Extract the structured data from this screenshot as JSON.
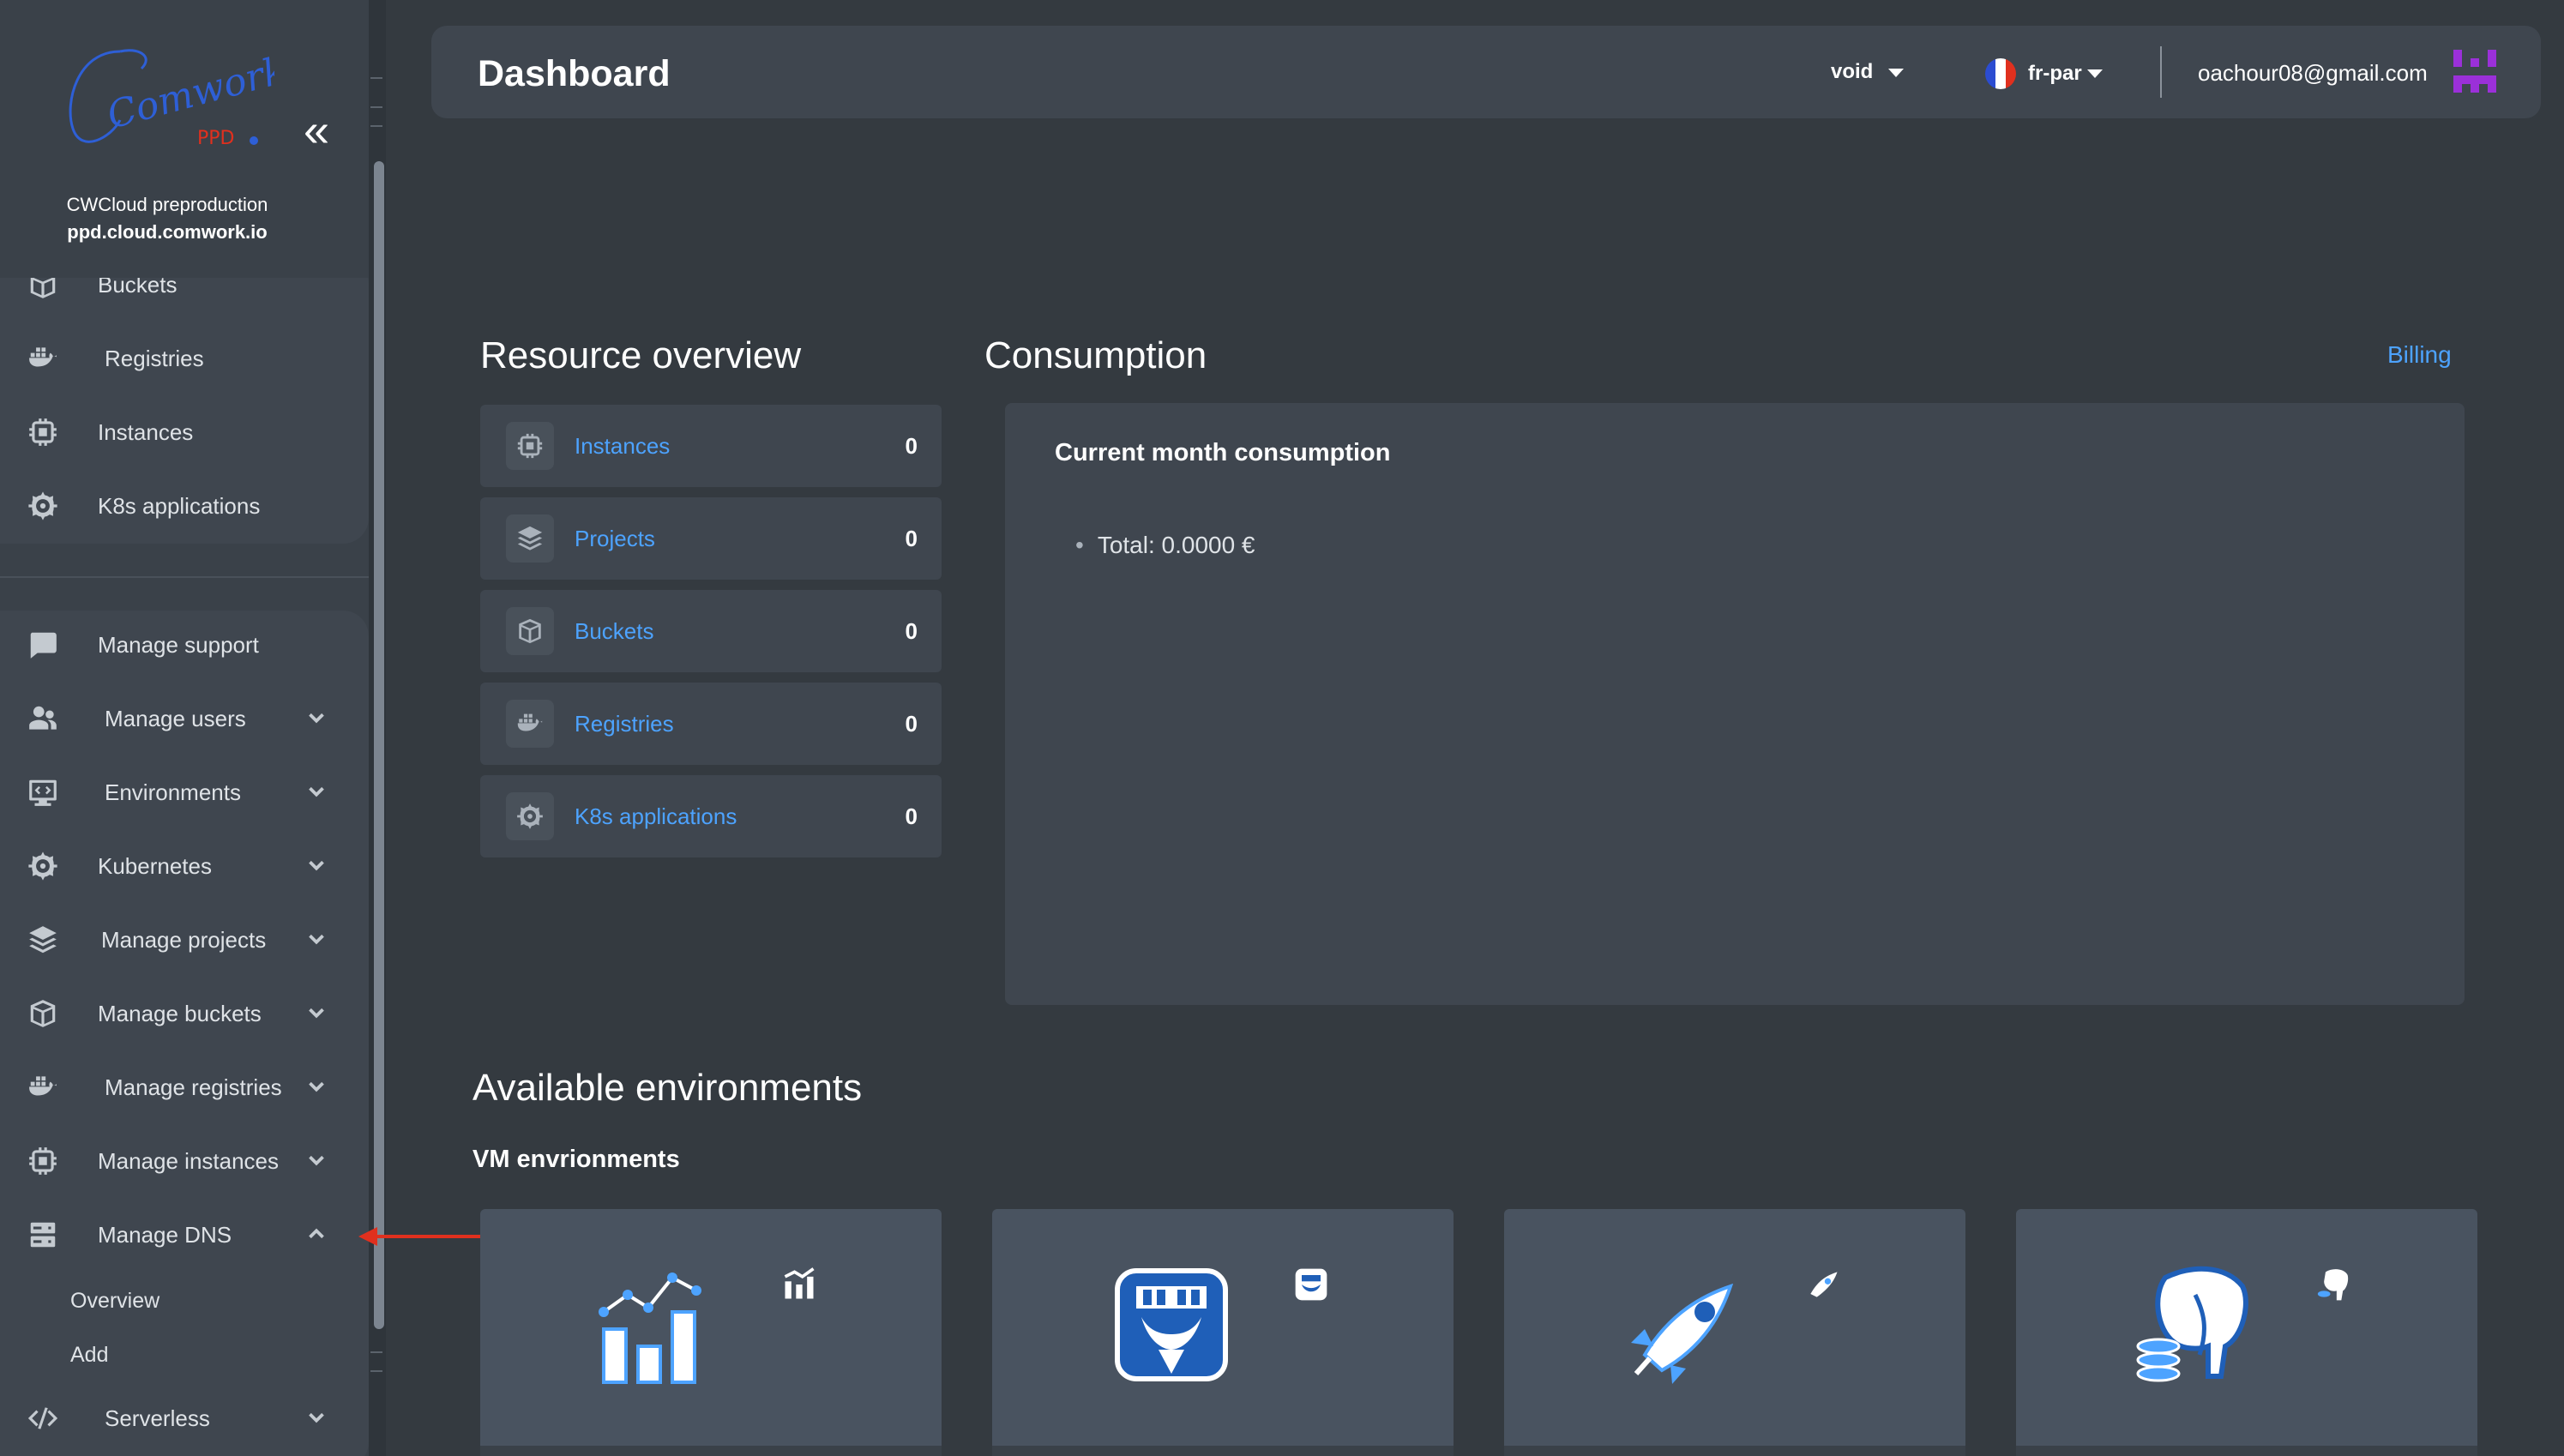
{
  "sidebar": {
    "logo_text": "Comwork",
    "logo_sub": "PPD",
    "org_name": "CWCloud preproduction",
    "org_domain": "ppd.cloud.comwork.io",
    "top_items": [
      {
        "label": "Buckets",
        "icon": "bucket-icon"
      },
      {
        "label": "Registries",
        "icon": "docker-icon"
      },
      {
        "label": "Instances",
        "icon": "chip-icon"
      },
      {
        "label": "K8s applications",
        "icon": "helm-icon"
      }
    ],
    "manage_items": [
      {
        "label": "Manage support",
        "icon": "chat-icon"
      },
      {
        "label": "Manage users",
        "icon": "users-icon"
      },
      {
        "label": "Environments",
        "icon": "code-monitor-icon"
      },
      {
        "label": "Kubernetes",
        "icon": "helm-icon"
      },
      {
        "label": "Manage projects",
        "icon": "layers-icon"
      },
      {
        "label": "Manage buckets",
        "icon": "bucket-icon"
      },
      {
        "label": "Manage registries",
        "icon": "docker-icon"
      },
      {
        "label": "Manage instances",
        "icon": "chip-icon"
      },
      {
        "label": "Manage DNS",
        "icon": "server-icon"
      }
    ],
    "dns_subitems": [
      "Overview",
      "Add"
    ],
    "serverless_label": "Serverless"
  },
  "header": {
    "title": "Dashboard",
    "project": "void",
    "region": "fr-par",
    "user_email": "oachour08@gmail.com"
  },
  "resource_overview": {
    "title": "Resource overview",
    "items": [
      {
        "label": "Instances",
        "count": "0"
      },
      {
        "label": "Projects",
        "count": "0"
      },
      {
        "label": "Buckets",
        "count": "0"
      },
      {
        "label": "Registries",
        "count": "0"
      },
      {
        "label": "K8s applications",
        "count": "0"
      }
    ]
  },
  "consumption": {
    "title": "Consumption",
    "billing_label": "Billing",
    "card_title": "Current month consumption",
    "total": "Total: 0.0000 €"
  },
  "environments": {
    "title": "Available environments",
    "vm_label": "VM envrionments"
  },
  "colors": {
    "accent_link": "#4da3ff",
    "arrow": "#e0301e",
    "avatar": "#9b30d9"
  }
}
